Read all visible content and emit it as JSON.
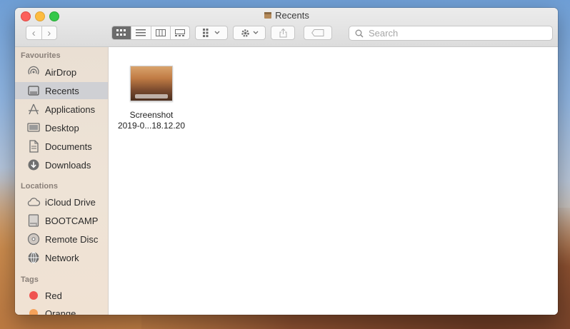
{
  "window": {
    "title": "Recents"
  },
  "toolbar": {
    "search_placeholder": "Search",
    "back_glyph": "‹",
    "forward_glyph": "›"
  },
  "sidebar": {
    "favourites_header": "Favourites",
    "favourites": [
      {
        "label": "AirDrop",
        "icon": "airdrop-icon"
      },
      {
        "label": "Recents",
        "icon": "recents-icon",
        "selected": true
      },
      {
        "label": "Applications",
        "icon": "applications-icon"
      },
      {
        "label": "Desktop",
        "icon": "desktop-icon"
      },
      {
        "label": "Documents",
        "icon": "documents-icon"
      },
      {
        "label": "Downloads",
        "icon": "downloads-icon"
      }
    ],
    "locations_header": "Locations",
    "locations": [
      {
        "label": "iCloud Drive",
        "icon": "cloud-icon"
      },
      {
        "label": "BOOTCAMP",
        "icon": "disk-icon"
      },
      {
        "label": "Remote Disc",
        "icon": "disc-icon"
      },
      {
        "label": "Network",
        "icon": "network-icon"
      }
    ],
    "tags_header": "Tags",
    "tags": [
      {
        "label": "Red",
        "color": "#ef5350"
      },
      {
        "label": "Orange",
        "color": "#f5a25a"
      }
    ]
  },
  "files": [
    {
      "name_line1": "Screenshot",
      "name_line2": "2019-0...18.12.20",
      "icon": "image-thumbnail"
    }
  ]
}
